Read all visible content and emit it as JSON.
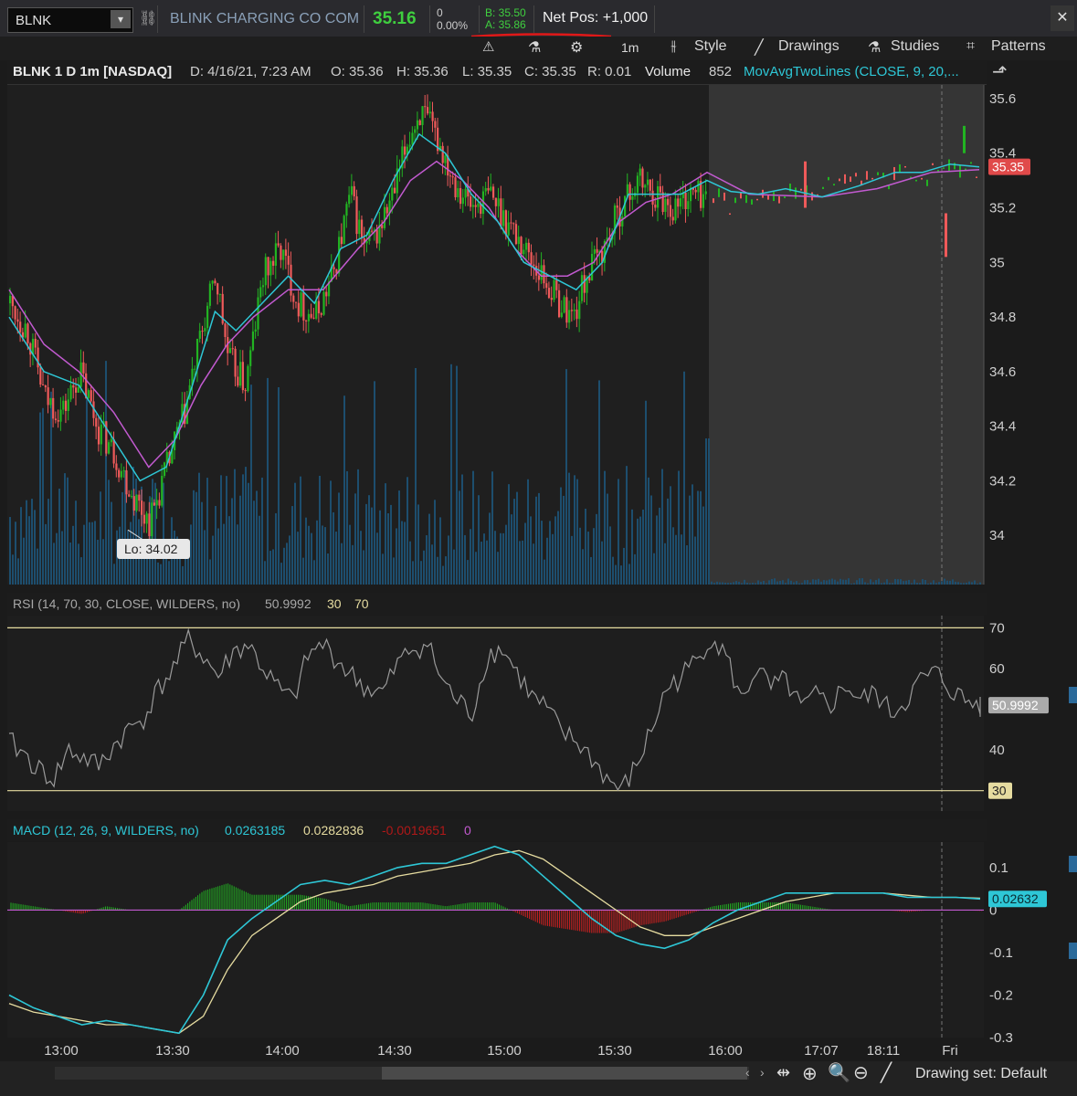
{
  "toolbar": {
    "symbol": "BLNK",
    "company": "BLINK CHARGING CO COM",
    "last": "35.16",
    "change_top": "0",
    "change_pct": "0.00%",
    "bid": "B: 35.50",
    "ask": "A: 35.86",
    "net_pos": "Net Pos: +1,000",
    "timeframe": "1m",
    "style_label": "Style",
    "drawings_label": "Drawings",
    "studies_label": "Studies",
    "patterns_label": "Patterns"
  },
  "header": {
    "title": "BLNK 1 D 1m [NASDAQ]",
    "date": "D: 4/16/21, 7:23 AM",
    "open": "O: 35.36",
    "high": "H: 35.36",
    "low": "L: 35.35",
    "close": "C: 35.35",
    "range": "R: 0.01",
    "volume_label": "Volume",
    "volume_value": "852",
    "study": "MovAvgTwoLines (CLOSE, 9, 20,..."
  },
  "rsi": {
    "label": "RSI (14, 70, 30, CLOSE, WILDERS, no)",
    "value": "50.9992",
    "lower": "30",
    "upper": "70"
  },
  "macd": {
    "label": "MACD (12, 26, 9, WILDERS, no)",
    "value": "0.0263185",
    "avg": "0.0282836",
    "diff": "-0.0019651",
    "zero": "0",
    "badge": "0.02632"
  },
  "price_badge": "35.35",
  "lo_label": "Lo: 34.02",
  "bottom": {
    "drawing_set": "Drawing set: Default"
  },
  "colors": {
    "up": "#22b422",
    "down": "#ef5a5a",
    "ma_fast": "#2ec7d6",
    "ma_slow": "#c25ad0",
    "volume": "#1d4e6e",
    "extended_bg": "#353535",
    "rsi_line": "#9a9a9a",
    "macd_line": "#2ec7d6",
    "macd_avg": "#e6dca0"
  },
  "chart_data": [
    {
      "type": "candlestick",
      "title": "BLNK 1 D 1m [NASDAQ]",
      "y_ticks": [
        35.6,
        35.4,
        35.2,
        35,
        34.8,
        34.6,
        34.4,
        34.2,
        34
      ],
      "ylim": [
        33.82,
        35.65
      ],
      "x_ticks": [
        "13:00",
        "13:30",
        "14:00",
        "14:30",
        "15:00",
        "15:30",
        "16:00",
        "17:07",
        "18:11",
        "Fri"
      ],
      "close_path": [
        [
          0,
          34.85
        ],
        [
          10,
          34.75
        ],
        [
          20,
          34.5
        ],
        [
          30,
          34.45
        ],
        [
          40,
          34.6
        ],
        [
          50,
          34.4
        ],
        [
          60,
          34.3
        ],
        [
          70,
          34.15
        ],
        [
          80,
          34.05
        ],
        [
          90,
          34.25
        ],
        [
          100,
          34.45
        ],
        [
          110,
          34.75
        ],
        [
          118,
          34.95
        ],
        [
          125,
          34.65
        ],
        [
          135,
          34.55
        ],
        [
          145,
          34.95
        ],
        [
          155,
          35.05
        ],
        [
          165,
          34.85
        ],
        [
          175,
          34.8
        ],
        [
          185,
          34.95
        ],
        [
          195,
          35.25
        ],
        [
          203,
          35.05
        ],
        [
          210,
          35.1
        ],
        [
          220,
          35.25
        ],
        [
          228,
          35.45
        ],
        [
          235,
          35.55
        ],
        [
          245,
          35.45
        ],
        [
          255,
          35.3
        ],
        [
          265,
          35.2
        ],
        [
          275,
          35.25
        ],
        [
          285,
          35.15
        ],
        [
          295,
          35.05
        ],
        [
          305,
          34.95
        ],
        [
          315,
          34.85
        ],
        [
          323,
          34.8
        ],
        [
          330,
          34.95
        ],
        [
          340,
          35.05
        ],
        [
          350,
          35.2
        ],
        [
          360,
          35.3
        ],
        [
          370,
          35.25
        ],
        [
          380,
          35.2
        ],
        [
          390,
          35.25
        ],
        [
          400,
          35.25
        ]
      ],
      "ma_fast_path": [
        [
          0,
          34.8
        ],
        [
          20,
          34.6
        ],
        [
          40,
          34.55
        ],
        [
          60,
          34.35
        ],
        [
          75,
          34.2
        ],
        [
          90,
          34.25
        ],
        [
          105,
          34.55
        ],
        [
          118,
          34.82
        ],
        [
          130,
          34.75
        ],
        [
          145,
          34.85
        ],
        [
          160,
          34.95
        ],
        [
          175,
          34.85
        ],
        [
          190,
          35.05
        ],
        [
          205,
          35.1
        ],
        [
          220,
          35.3
        ],
        [
          235,
          35.47
        ],
        [
          250,
          35.4
        ],
        [
          265,
          35.25
        ],
        [
          280,
          35.15
        ],
        [
          295,
          35.0
        ],
        [
          310,
          34.95
        ],
        [
          325,
          34.9
        ],
        [
          340,
          35.0
        ],
        [
          355,
          35.25
        ],
        [
          370,
          35.25
        ],
        [
          385,
          35.25
        ],
        [
          400,
          35.3
        ]
      ],
      "ma_slow_path": [
        [
          0,
          34.9
        ],
        [
          20,
          34.7
        ],
        [
          40,
          34.6
        ],
        [
          60,
          34.45
        ],
        [
          80,
          34.25
        ],
        [
          95,
          34.35
        ],
        [
          110,
          34.55
        ],
        [
          125,
          34.7
        ],
        [
          140,
          34.8
        ],
        [
          160,
          34.9
        ],
        [
          180,
          34.9
        ],
        [
          200,
          35.05
        ],
        [
          215,
          35.15
        ],
        [
          230,
          35.3
        ],
        [
          245,
          35.37
        ],
        [
          260,
          35.3
        ],
        [
          275,
          35.2
        ],
        [
          290,
          35.05
        ],
        [
          305,
          34.95
        ],
        [
          320,
          34.95
        ],
        [
          335,
          35.0
        ],
        [
          350,
          35.15
        ],
        [
          365,
          35.22
        ],
        [
          380,
          35.25
        ],
        [
          400,
          35.33
        ]
      ],
      "last": 35.35,
      "low": 34.02
    },
    {
      "type": "line",
      "title": "RSI (14, 70, 30, CLOSE, WILDERS, no)",
      "y_ticks": [
        70,
        60,
        50,
        40,
        30
      ],
      "ylim": [
        25,
        73
      ],
      "levels": [
        70,
        30
      ],
      "values": [
        42,
        39,
        35,
        33,
        40,
        38,
        36,
        41,
        45,
        48,
        55,
        60,
        67,
        63,
        58,
        64,
        66,
        60,
        55,
        52,
        63,
        66,
        62,
        58,
        55,
        54,
        61,
        65,
        66,
        57,
        52,
        49,
        63,
        65,
        59,
        53,
        50,
        44,
        42,
        38,
        33,
        30,
        36,
        45,
        55,
        58,
        62,
        68,
        63,
        52,
        60,
        55,
        57,
        50,
        53,
        51,
        56,
        52,
        54,
        49,
        52,
        57,
        59,
        55,
        52,
        51
      ]
    },
    {
      "type": "line",
      "title": "MACD (12, 26, 9, WILDERS, no)",
      "y_ticks": [
        0.1,
        0,
        -0.1,
        -0.2,
        -0.3
      ],
      "ylim": [
        -0.3,
        0.16
      ],
      "macd": [
        -0.2,
        -0.23,
        -0.25,
        -0.27,
        -0.26,
        -0.27,
        -0.28,
        -0.29,
        -0.2,
        -0.07,
        -0.02,
        0.02,
        0.06,
        0.07,
        0.06,
        0.08,
        0.1,
        0.11,
        0.11,
        0.13,
        0.15,
        0.13,
        0.08,
        0.03,
        -0.02,
        -0.06,
        -0.08,
        -0.09,
        -0.07,
        -0.03,
        0.0,
        0.02,
        0.04,
        0.04,
        0.04,
        0.04,
        0.04,
        0.03,
        0.03,
        0.03,
        0.026
      ],
      "avg": [
        -0.22,
        -0.24,
        -0.25,
        -0.26,
        -0.27,
        -0.27,
        -0.28,
        -0.29,
        -0.25,
        -0.14,
        -0.06,
        -0.02,
        0.02,
        0.04,
        0.05,
        0.06,
        0.08,
        0.09,
        0.1,
        0.11,
        0.13,
        0.14,
        0.12,
        0.08,
        0.04,
        0.0,
        -0.04,
        -0.06,
        -0.06,
        -0.04,
        -0.02,
        0.0,
        0.02,
        0.03,
        0.04,
        0.04,
        0.04,
        0.035,
        0.03,
        0.03,
        0.028
      ]
    }
  ]
}
